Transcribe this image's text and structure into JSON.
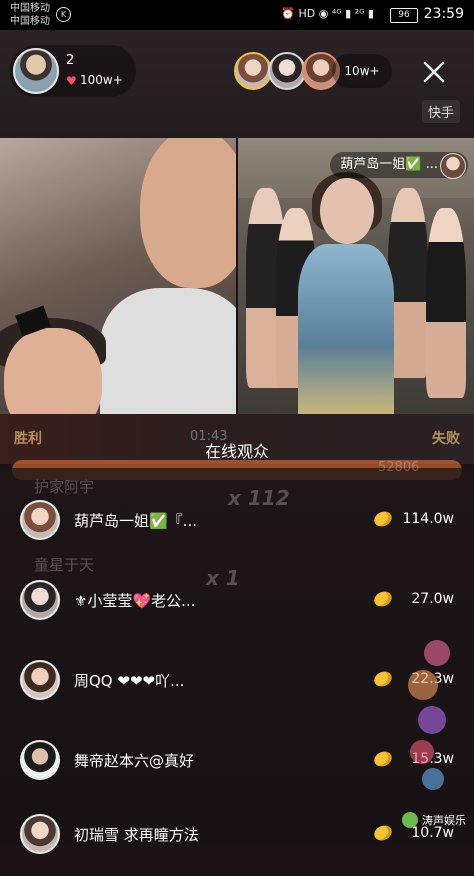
{
  "status_bar": {
    "carrier_1": "中国移动",
    "carrier_2": "中国移动",
    "indicators": "⏰ HD ◉ ⁴ᴳ ▮ ²ᴳ ▮",
    "battery": "96",
    "time": "23:59"
  },
  "header": {
    "host_name": "2",
    "likes": "100w+",
    "viewer_count": "10w+",
    "tag": "快手"
  },
  "pk": {
    "opponent_name": "葫芦岛一姐✅ ...",
    "win_label": "胜利",
    "lose_label": "失败",
    "timer": "01:43"
  },
  "panel": {
    "title": "在线观众",
    "rows": [
      {
        "name": "葫芦岛一姐✅『...",
        "score": "114.0w"
      },
      {
        "name": "⚜小莹莹💖老公...",
        "score": "27.0w"
      },
      {
        "name": "周QQ ❤❤❤吖...",
        "score": "22.3w"
      },
      {
        "name": "舞帝赵本六@真好",
        "score": "15.3w"
      },
      {
        "name": "初瑞雪 求再瞳方法",
        "score": "10.7w"
      }
    ]
  },
  "background_ghosts": {
    "g1": "护家阿宇",
    "g2": "x 112",
    "g3": "童星于天",
    "g4": "x 1",
    "g5": "52806"
  },
  "watermark": "涛声娱乐",
  "colors": {
    "heart": "#ff4f6a",
    "coin": "#f4c430",
    "pk_progress": "#ff7c3a"
  }
}
